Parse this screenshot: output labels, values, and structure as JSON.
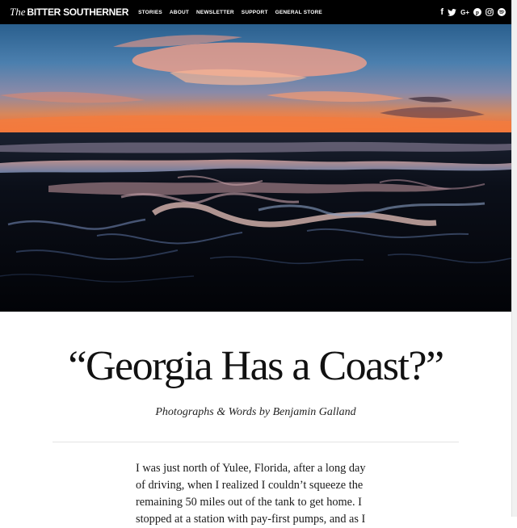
{
  "header": {
    "logo_the": "The",
    "logo_name": "BITTER SOUTHERNER",
    "nav": [
      "STORIES",
      "ABOUT",
      "NEWSLETTER",
      "SUPPORT",
      "GENERAL STORE"
    ],
    "social": [
      {
        "icon": "facebook-icon",
        "glyph": "f"
      },
      {
        "icon": "twitter-icon",
        "glyph": "🐦"
      },
      {
        "icon": "google-plus-icon",
        "glyph": "G+"
      },
      {
        "icon": "pinterest-icon",
        "glyph": "P"
      },
      {
        "icon": "instagram-icon",
        "glyph": ""
      },
      {
        "icon": "spotify-icon",
        "glyph": ""
      }
    ]
  },
  "article": {
    "title": "“Georgia Has a Coast?”",
    "byline": "Photographs & Words by Benjamin Galland",
    "body": "I was just north of Yulee, Florida, after a long day of driving, when I realized I couldn’t squeeze the remaining 50 miles out of the tank to get home. I stopped at a station with pay-first pumps, and as I"
  },
  "colors": {
    "topbar": "#000000",
    "page": "#ffffff",
    "text": "#111111"
  }
}
